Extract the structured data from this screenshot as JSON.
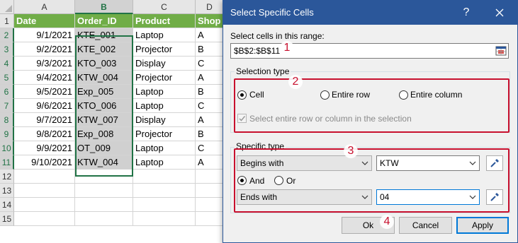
{
  "spreadsheet": {
    "columns": [
      "A",
      "B",
      "C",
      "D"
    ],
    "rows": [
      "1",
      "2",
      "3",
      "4",
      "5",
      "6",
      "7",
      "8",
      "9",
      "10",
      "11",
      "12",
      "13",
      "14",
      "15"
    ],
    "headers": [
      "Date",
      "Order_ID",
      "Product",
      "Shop"
    ],
    "data": [
      [
        "9/1/2021",
        "KTE_001",
        "Laptop",
        "A"
      ],
      [
        "9/2/2021",
        "KTE_002",
        "Projector",
        "B"
      ],
      [
        "9/3/2021",
        "KTO_003",
        "Display",
        "C"
      ],
      [
        "9/4/2021",
        "KTW_004",
        "Projector",
        "A"
      ],
      [
        "9/5/2021",
        "Exp_005",
        "Laptop",
        "B"
      ],
      [
        "9/6/2021",
        "KTO_006",
        "Laptop",
        "C"
      ],
      [
        "9/7/2021",
        "KTW_007",
        "Display",
        "A"
      ],
      [
        "9/8/2021",
        "Exp_008",
        "Projector",
        "B"
      ],
      [
        "9/9/2021",
        "OT_009",
        "Laptop",
        "C"
      ],
      [
        "9/10/2021",
        "KTW_004",
        "Laptop",
        "A"
      ]
    ],
    "header_color": "#70ad47",
    "selection_color": "#217346"
  },
  "dialog": {
    "title": "Select Specific Cells",
    "help_icon": "question-mark-icon",
    "close_icon": "close-icon",
    "range_label": "Select cells in this range:",
    "range_value": "$B$2:$B$11",
    "range_picker_icon": "range-select-icon",
    "selection_type": {
      "title": "Selection type",
      "options": [
        "Cell",
        "Entire row",
        "Entire column"
      ],
      "selected": "Cell",
      "checkbox_label": "Select entire row or column in the selection",
      "checkbox_checked": true,
      "checkbox_disabled": true
    },
    "specific_type": {
      "title": "Specific type",
      "first_condition": "Begins with",
      "first_value": "KTW",
      "logic_options": [
        "And",
        "Or"
      ],
      "logic_selected": "And",
      "second_condition": "Ends with",
      "second_value": "04",
      "picker_icon": "eyedropper-icon"
    },
    "buttons": {
      "ok": "Ok",
      "cancel": "Cancel",
      "apply": "Apply"
    },
    "accent_color": "#2b579a",
    "highlight_color": "#c8102e"
  },
  "markers": [
    "1",
    "2",
    "3",
    "4"
  ]
}
